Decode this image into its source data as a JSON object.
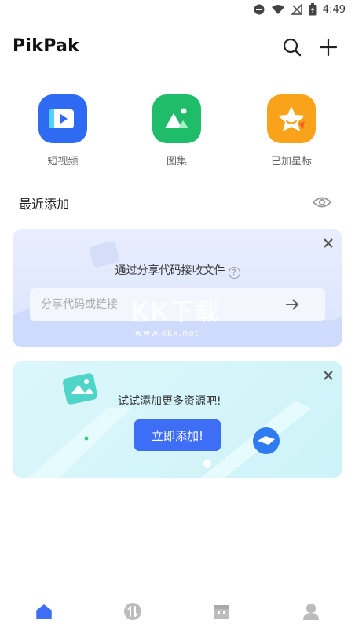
{
  "status_bar": {
    "time": "4:49",
    "icons": [
      "do-not-disturb-icon",
      "wifi-icon",
      "no-signal-icon",
      "battery-charging-icon"
    ]
  },
  "app_bar": {
    "title": "PikPak",
    "actions": [
      "search-icon",
      "plus-icon"
    ]
  },
  "quick_access": [
    {
      "label": "短视频",
      "icon": "video-icon",
      "color": "#2f6bf2"
    },
    {
      "label": "图集",
      "icon": "image-icon",
      "color": "#1fbd6a"
    },
    {
      "label": "已加星标",
      "icon": "star-icon",
      "color": "#f9a31a"
    }
  ],
  "recent": {
    "title": "最近添加",
    "visibility_icon": "eye-icon"
  },
  "share_code_card": {
    "headline": "通过分享代码接收文件",
    "help_icon": "question-circle-icon",
    "help_glyph": "?",
    "input_placeholder": "分享代码或链接",
    "submit_icon": "arrow-right-icon",
    "close_icon": "close-icon",
    "watermark": "KK下载",
    "watermark_url": "www.kkx.net"
  },
  "add_resource_card": {
    "headline": "试试添加更多资源吧!",
    "button_label": "立即添加!",
    "close_icon": "close-icon"
  },
  "tab_bar": [
    {
      "name": "home",
      "icon": "home-icon",
      "active": true
    },
    {
      "name": "transfer",
      "icon": "transfer-icon",
      "active": false
    },
    {
      "name": "box",
      "icon": "box-icon",
      "active": false
    },
    {
      "name": "profile",
      "icon": "person-icon",
      "active": false
    }
  ],
  "colors": {
    "accent": "#3e6ef6",
    "card1_bg": "#e2e9fe",
    "card2_bg": "#d4f5fa",
    "inactive_icon": "#bcbcbc"
  }
}
